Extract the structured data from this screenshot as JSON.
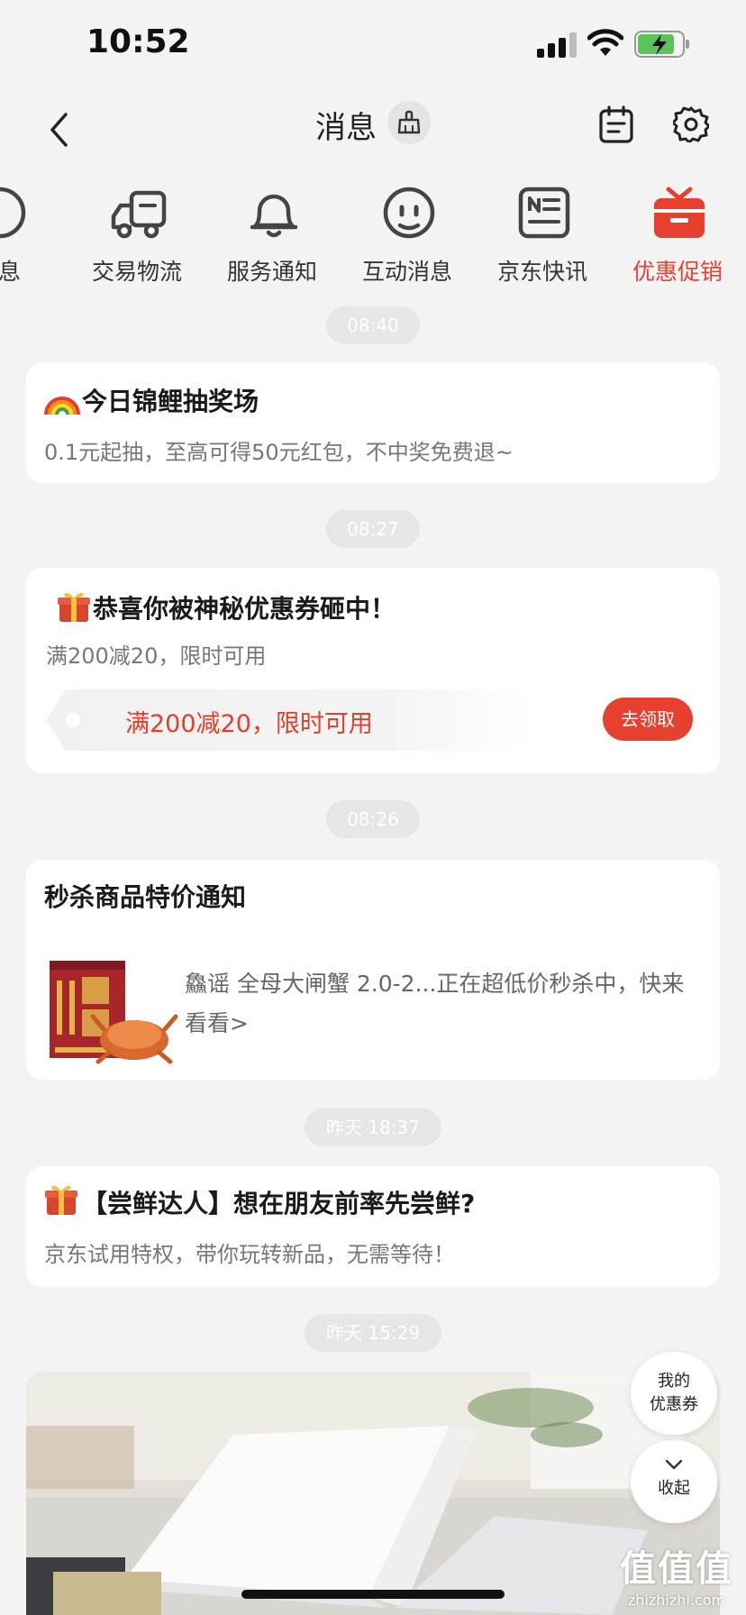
{
  "status_bar": {
    "time": "10:52"
  },
  "header": {
    "title": "消息"
  },
  "tabs": [
    {
      "label": "消息",
      "icon": "chat-icon"
    },
    {
      "label": "交易物流",
      "icon": "truck-icon"
    },
    {
      "label": "服务通知",
      "icon": "bell-icon"
    },
    {
      "label": "互动消息",
      "icon": "face-icon"
    },
    {
      "label": "京东快讯",
      "icon": "news-icon"
    },
    {
      "label": "优惠促销",
      "icon": "gift-icon",
      "active": true
    }
  ],
  "accent_color": "#e8402f",
  "messages": [
    {
      "time": "08:40",
      "title": "今日锦鲤抽奖场",
      "body": "0.1元起抽，至高可得50元红包，不中奖免费退~"
    },
    {
      "time": "08:27",
      "title": "恭喜你被神秘优惠券砸中！",
      "body": "满200减20，限时可用",
      "coupon_text": "满200减20，限时可用",
      "button": "去领取"
    },
    {
      "time": "08:26",
      "title": "秒杀商品特价通知",
      "body": "鱻谣 全母大闸蟹 2.0-2...正在超低价秒杀中，快来看看>"
    },
    {
      "time": "昨天 18:37",
      "title": "【尝鲜达人】想在朋友前率先尝鲜?",
      "body": "京东试用特权，带你玩转新品，无需等待！"
    },
    {
      "time": "昨天 15:29"
    }
  ],
  "floating": {
    "coupon_line1": "我的",
    "coupon_line2": "优惠券",
    "collapse": "收起"
  },
  "watermark": {
    "big": "值值值",
    "small": "zhizhizhi.com"
  }
}
